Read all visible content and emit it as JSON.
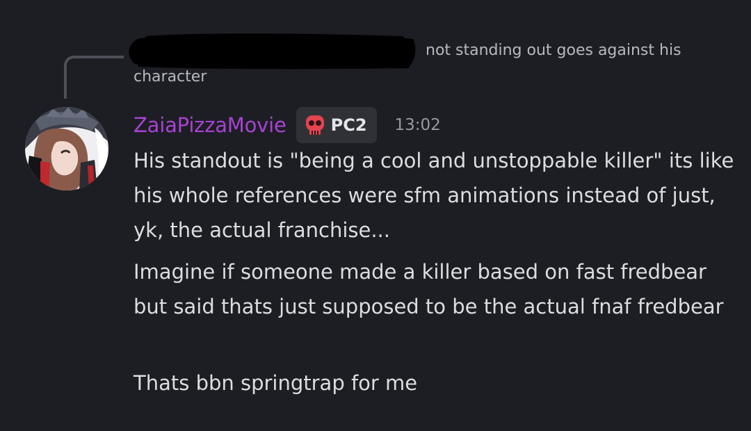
{
  "reply": {
    "author_redacted": true,
    "text_line1": "not standing out goes against his",
    "text_line2": "character"
  },
  "message": {
    "username": "ZaiaPizzaMovie",
    "username_color": "#a742d4",
    "tag": {
      "icon": "red-skull-icon",
      "label": "PC2"
    },
    "timestamp": "13:02",
    "lines": [
      "His standout is \"being a cool and unstoppable killer\" its like his whole references were sfm animations instead of just, yk, the actual franchise...",
      "Imagine if someone made a killer based on fast fredbear but said thats just supposed to be the actual fnaf fredbear",
      "Thats bbn springtrap for me"
    ]
  },
  "colors": {
    "background": "#1d1e23",
    "text": "#dbdee1",
    "muted": "#949ba4",
    "tag_bg": "#303136"
  }
}
